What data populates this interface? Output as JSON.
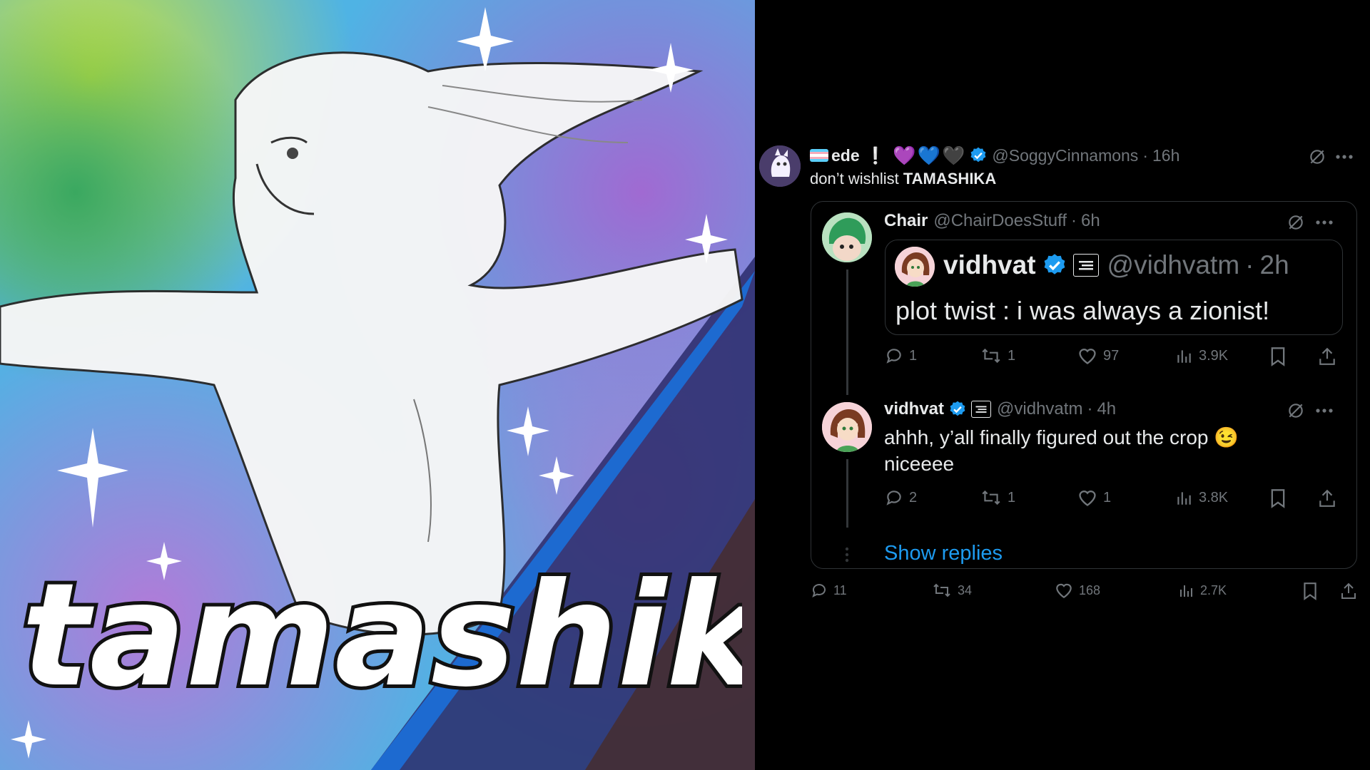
{
  "artwork": {
    "title_text": "tamashika"
  },
  "colors": {
    "accent_blue": "#1d9bf0",
    "muted": "#71767b",
    "text": "#e7e9ea",
    "border": "#2f3336"
  },
  "main_tweet": {
    "display_name": "ede",
    "name_suffix": "❕",
    "hearts": [
      "💜",
      "💙",
      "🖤"
    ],
    "handle": "@SoggyCinnamons",
    "separator": "·",
    "time": "16h",
    "text_prefix": "don’t wishlist ",
    "text_bold": "TAMASHIKA",
    "metrics": {
      "replies": "11",
      "reposts": "34",
      "likes": "168",
      "views": "2.7K"
    }
  },
  "quoted_tweet": {
    "display_name": "Chair",
    "handle": "@ChairDoesStuff",
    "separator": "·",
    "time": "6h",
    "metrics": {
      "replies": "1",
      "reposts": "1",
      "likes": "97",
      "views": "3.9K"
    }
  },
  "inner_quote": {
    "display_name": "vidhvat",
    "handle": "@vidhvatm",
    "separator": "·",
    "time": "2h",
    "text": "plot twist : i was always a zionist!"
  },
  "reply_tweet": {
    "display_name": "vidhvat",
    "handle": "@vidhvatm",
    "separator": "·",
    "time": "4h",
    "text_line1": "ahhh, y’all finally figured out the crop 😉",
    "text_line2": "niceeee",
    "metrics": {
      "replies": "2",
      "reposts": "1",
      "likes": "1",
      "views": "3.8K"
    }
  },
  "show_replies_label": "Show replies",
  "icons": [
    "grok-icon",
    "more-icon",
    "reply-icon",
    "repost-icon",
    "like-icon",
    "views-icon",
    "bookmark-icon",
    "share-icon",
    "verified-icon"
  ]
}
